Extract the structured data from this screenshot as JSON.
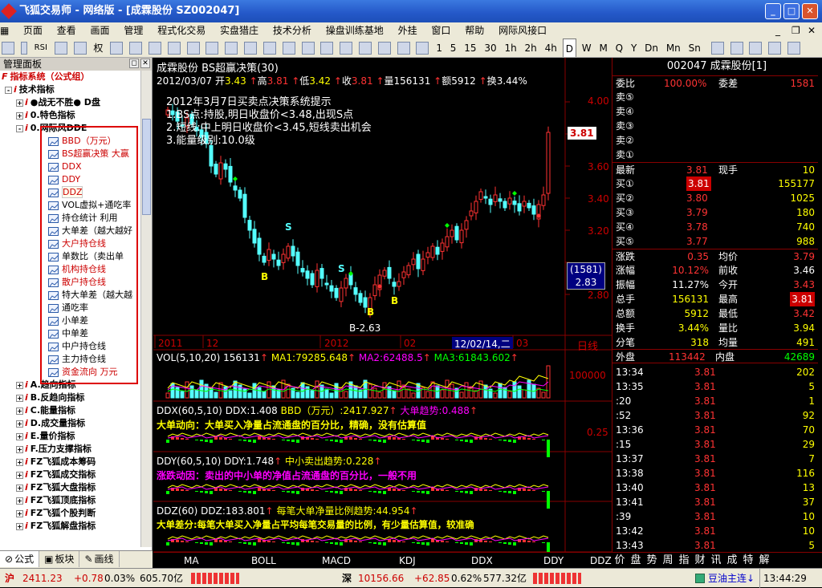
{
  "window": {
    "title": "飞狐交易师 - 网络版 - [成霖股份  SZ002047]"
  },
  "menu": [
    "页面",
    "查看",
    "画面",
    "管理",
    "程式化交易",
    "实盘猎庄",
    "技术分析",
    "操盘训练基地",
    "外挂",
    "窗口",
    "帮助",
    "网际风接口"
  ],
  "toolbar": {
    "rsi": "RSI",
    "quan": "权",
    "periods": [
      "1",
      "5",
      "15",
      "30",
      "1h",
      "2h",
      "4h",
      "D",
      "W",
      "M",
      "Q",
      "Y",
      "Dn",
      "Mn",
      "Sn"
    ],
    "active_period": "D"
  },
  "panel": {
    "title": "管理面板",
    "items": [
      {
        "label": "指标系统（公式组）",
        "icon": "i-icon",
        "toggle": "",
        "indent": 0,
        "style": "red-bold"
      },
      {
        "label": "技术指标",
        "icon": "i-icon",
        "toggle": "-",
        "indent": 1,
        "style": "bold"
      },
      {
        "label": "●战无不胜● D盘",
        "icon": "i-icon",
        "toggle": "+",
        "indent": 2,
        "style": "bold"
      },
      {
        "label": "0.特色指标",
        "icon": "i-icon",
        "toggle": "+",
        "indent": 2,
        "style": "bold"
      },
      {
        "label": "0.网际风DDE",
        "icon": "i-icon",
        "toggle": "-",
        "indent": 2,
        "style": "bold"
      },
      {
        "label": "BBD（万元）",
        "icon": "formula",
        "toggle": "",
        "indent": 3,
        "style": "red"
      },
      {
        "label": "BS超赢决策   大赢",
        "icon": "formula",
        "toggle": "",
        "indent": 3,
        "style": "red"
      },
      {
        "label": "DDX",
        "icon": "formula",
        "toggle": "",
        "indent": 3,
        "style": "red"
      },
      {
        "label": "DDY",
        "icon": "formula",
        "toggle": "",
        "indent": 3,
        "style": "red"
      },
      {
        "label": "DDZ",
        "icon": "formula",
        "toggle": "",
        "indent": 3,
        "style": "red-hl"
      },
      {
        "label": "VOL虚拟+通吃率",
        "icon": "formula",
        "toggle": "",
        "indent": 3,
        "style": ""
      },
      {
        "label": "持仓统计   利用",
        "icon": "formula",
        "toggle": "",
        "indent": 3,
        "style": ""
      },
      {
        "label": "大单差（越大越好",
        "icon": "formula",
        "toggle": "",
        "indent": 3,
        "style": ""
      },
      {
        "label": "大户持仓线",
        "icon": "formula",
        "toggle": "",
        "indent": 3,
        "style": "red"
      },
      {
        "label": "单数比（卖出单",
        "icon": "formula",
        "toggle": "",
        "indent": 3,
        "style": ""
      },
      {
        "label": "机构持仓线",
        "icon": "formula",
        "toggle": "",
        "indent": 3,
        "style": "red"
      },
      {
        "label": "散户持仓线",
        "icon": "formula",
        "toggle": "",
        "indent": 3,
        "style": "red"
      },
      {
        "label": "特大单差（越大越",
        "icon": "formula",
        "toggle": "",
        "indent": 3,
        "style": ""
      },
      {
        "label": "通吃率",
        "icon": "formula",
        "toggle": "",
        "indent": 3,
        "style": ""
      },
      {
        "label": "小单差",
        "icon": "formula",
        "toggle": "",
        "indent": 3,
        "style": ""
      },
      {
        "label": "中单差",
        "icon": "formula",
        "toggle": "",
        "indent": 3,
        "style": ""
      },
      {
        "label": "中户持仓线",
        "icon": "formula",
        "toggle": "",
        "indent": 3,
        "style": ""
      },
      {
        "label": "主力持仓线",
        "icon": "formula",
        "toggle": "",
        "indent": 3,
        "style": ""
      },
      {
        "label": "资金流向      万元",
        "icon": "formula",
        "toggle": "",
        "indent": 3,
        "style": "red"
      },
      {
        "label": "A.趋向指标",
        "icon": "i-icon",
        "toggle": "+",
        "indent": 2,
        "style": "bold"
      },
      {
        "label": "B.反趋向指标",
        "icon": "i-icon",
        "toggle": "+",
        "indent": 2,
        "style": "bold"
      },
      {
        "label": "C.能量指标",
        "icon": "i-icon",
        "toggle": "+",
        "indent": 2,
        "style": "bold"
      },
      {
        "label": "D.成交量指标",
        "icon": "i-icon",
        "toggle": "+",
        "indent": 2,
        "style": "bold"
      },
      {
        "label": "E.量价指标",
        "icon": "i-icon",
        "toggle": "+",
        "indent": 2,
        "style": "bold"
      },
      {
        "label": "F.压力支撑指标",
        "icon": "i-icon",
        "toggle": "+",
        "indent": 2,
        "style": "bold"
      },
      {
        "label": "FZ飞狐成本筹码",
        "icon": "i-icon",
        "toggle": "+",
        "indent": 2,
        "style": "bold"
      },
      {
        "label": "FZ飞狐成交指标",
        "icon": "i-icon",
        "toggle": "+",
        "indent": 2,
        "style": "bold"
      },
      {
        "label": "FZ飞狐大盘指标",
        "icon": "i-icon",
        "toggle": "+",
        "indent": 2,
        "style": "bold"
      },
      {
        "label": "FZ飞狐顶底指标",
        "icon": "i-icon",
        "toggle": "+",
        "indent": 2,
        "style": "bold"
      },
      {
        "label": "FZ飞狐个股判断",
        "icon": "i-icon",
        "toggle": "+",
        "indent": 2,
        "style": "bold"
      },
      {
        "label": "FZ飞狐解盘指标",
        "icon": "i-icon",
        "toggle": "+",
        "indent": 2,
        "style": "bold"
      }
    ],
    "tabs": [
      "公式",
      "板块",
      "画线"
    ]
  },
  "chart": {
    "header": "成霖股份 BS超赢决策(30)",
    "date": "2012/03/07",
    "open_label": "开",
    "open": "3.43",
    "high_label": "高",
    "high": "3.81",
    "low_label": "低",
    "low": "3.42",
    "close_label": "收",
    "close": "3.81",
    "vol_label": "量",
    "vol": "156131",
    "amt_label": "额",
    "amt": "5912",
    "turn_label": "换",
    "turn": "3.44%",
    "notes": [
      "2012年3月7日买卖点决策系统提示",
      "1.BS点:持股,明日收盘价<3.48,出现S点",
      "2.短线:中上明日收盘价<3.45,短线卖出机会",
      "3.能量级别:10.0级"
    ],
    "price_axis": [
      "4.00",
      "3.60",
      "3.40",
      "3.20",
      "2.80"
    ],
    "cur_price": "3.81",
    "cursor_vol": "(1581)",
    "cursor_price": "2.83",
    "low_mark": "2.63",
    "date_axis": [
      "2011",
      "12",
      "2012",
      "02",
      "03"
    ],
    "cursor_date": "12/02/14,二",
    "period_label": "日线",
    "vol_line": {
      "prefix": "VOL(5,10,20)",
      "v": "156131",
      "ma1": "MA1:79285.648",
      "ma2": "MA2:62488.5",
      "ma3": "MA3:61843.602",
      "axis": "100000"
    },
    "ddx_line": {
      "prefix": "DDX(60,5,10)",
      "v": "DDX:1.408",
      "bbd": "BBD（万元）:2417.927",
      "trend": "大单趋势:0.488",
      "desc": "大单动向：大单买入净量占流通盘的百分比，精确，没有估算值",
      "axis": "0.25"
    },
    "ddy_line": {
      "prefix": "DDY(60,5,10)",
      "v": "DDY:1.748",
      "trend": "中小卖出趋势:0.228",
      "desc": "涨跌动因：卖出的中小单的净值占流通盘的百分比，一般不用"
    },
    "ddz_line": {
      "prefix": "DDZ(60)",
      "v": "DDZ:183.801",
      "trend": "每笔大单净量比例趋势:44.954",
      "desc": "大单差分:每笔大单买入净量占平均每笔交易量的比例，有少量估算值，较准确"
    },
    "bottom_tabs": [
      "MA",
      "BOLL",
      "MACD",
      "KDJ",
      "DDX",
      "DDY",
      "DDZ"
    ]
  },
  "chart_data": {
    "type": "candlestick",
    "title": "成霖股份 BS超赢决策(30)",
    "y_ticks": [
      4.0,
      3.6,
      3.4,
      3.2,
      2.8
    ],
    "x_ticks": [
      "2011",
      "12",
      "2012",
      "02",
      "03"
    ],
    "last": {
      "date": "2012/03/07",
      "open": 3.43,
      "high": 3.81,
      "low": 3.42,
      "close": 3.81,
      "volume": 156131
    },
    "period_low": 2.63,
    "closes": [
      3.95,
      3.92,
      3.88,
      3.85,
      3.9,
      3.86,
      3.82,
      3.78,
      3.74,
      3.6,
      3.55,
      3.62,
      3.58,
      3.5,
      3.45,
      3.4,
      3.28,
      3.2,
      3.12,
      3.05,
      3.0,
      3.08,
      3.02,
      2.98,
      3.05,
      3.1,
      3.04,
      2.98,
      2.94,
      2.9,
      2.86,
      2.95,
      2.9,
      2.86,
      2.82,
      2.78,
      2.84,
      2.9,
      2.86,
      2.8,
      2.75,
      2.72,
      2.78,
      2.86,
      2.92,
      2.95,
      2.9,
      2.85,
      2.88,
      2.94,
      2.98,
      3.02,
      2.96,
      3.02,
      3.06,
      3.1,
      3.05,
      3.12,
      3.16,
      3.2,
      3.14,
      3.2,
      3.26,
      3.32,
      3.38,
      3.44,
      3.4,
      3.36,
      3.42,
      3.38,
      3.34,
      3.4,
      3.36,
      3.32,
      3.38,
      3.34,
      3.3,
      3.36,
      3.42,
      3.81
    ]
  },
  "quote": {
    "code_name": "002047 成霖股份[1]",
    "wb_label": "委比",
    "wb": "100.00%",
    "wc_label": "委差",
    "wc": "1581",
    "asks": [
      [
        "卖⑤",
        ""
      ],
      [
        "卖④",
        ""
      ],
      [
        "卖③",
        ""
      ],
      [
        "卖②",
        ""
      ],
      [
        "卖①",
        ""
      ]
    ],
    "latest_label": "最新",
    "latest": "3.81",
    "xs_label": "现手",
    "xs": "10",
    "bids": [
      [
        "买①",
        "3.81",
        "155177"
      ],
      [
        "买②",
        "3.80",
        "1025"
      ],
      [
        "买③",
        "3.79",
        "180"
      ],
      [
        "买④",
        "3.78",
        "740"
      ],
      [
        "买⑤",
        "3.77",
        "988"
      ]
    ],
    "stats": [
      [
        "涨跌",
        "0.35",
        "均价",
        "3.79"
      ],
      [
        "涨幅",
        "10.12%",
        "前收",
        "3.46"
      ],
      [
        "振幅",
        "11.27%",
        "今开",
        "3.43"
      ],
      [
        "总手",
        "156131",
        "最高",
        "3.81"
      ],
      [
        "总额",
        "5912",
        "最低",
        "3.42"
      ],
      [
        "换手",
        "3.44%",
        "量比",
        "3.94"
      ],
      [
        "分笔",
        "318",
        "均量",
        "491"
      ]
    ],
    "outer_label": "外盘",
    "outer": "113442",
    "inner_label": "内盘",
    "inner": "42689",
    "ticks": [
      [
        "13:34",
        "3.81",
        "202"
      ],
      [
        "13:35",
        "3.81",
        "5"
      ],
      [
        ":20",
        "3.81",
        "1"
      ],
      [
        ":52",
        "3.81",
        "92"
      ],
      [
        "13:36",
        "3.81",
        "70"
      ],
      [
        ":15",
        "3.81",
        "29"
      ],
      [
        "13:37",
        "3.81",
        "7"
      ],
      [
        "13:38",
        "3.81",
        "116"
      ],
      [
        "13:40",
        "3.81",
        "13"
      ],
      [
        "13:41",
        "3.81",
        "37"
      ],
      [
        ":39",
        "3.81",
        "10"
      ],
      [
        "13:42",
        "3.81",
        "10"
      ],
      [
        "13:43",
        "3.81",
        "5"
      ]
    ],
    "tabs": [
      "价",
      "盘",
      "势",
      "周",
      "指",
      "财",
      "讯",
      "成",
      "特",
      "解"
    ]
  },
  "status": {
    "sh_label": "沪",
    "sh_index": "2411.23",
    "sh_change": "+0.78",
    "sh_pct": "0.03%",
    "sh_amt": "605.70亿",
    "sz_label": "深",
    "sz_index": "10156.66",
    "sz_change": "+62.85",
    "sz_pct": "0.62%",
    "sz_amt": "577.32亿",
    "ticker": "豆油主连↓",
    "time": "13:44:29"
  }
}
